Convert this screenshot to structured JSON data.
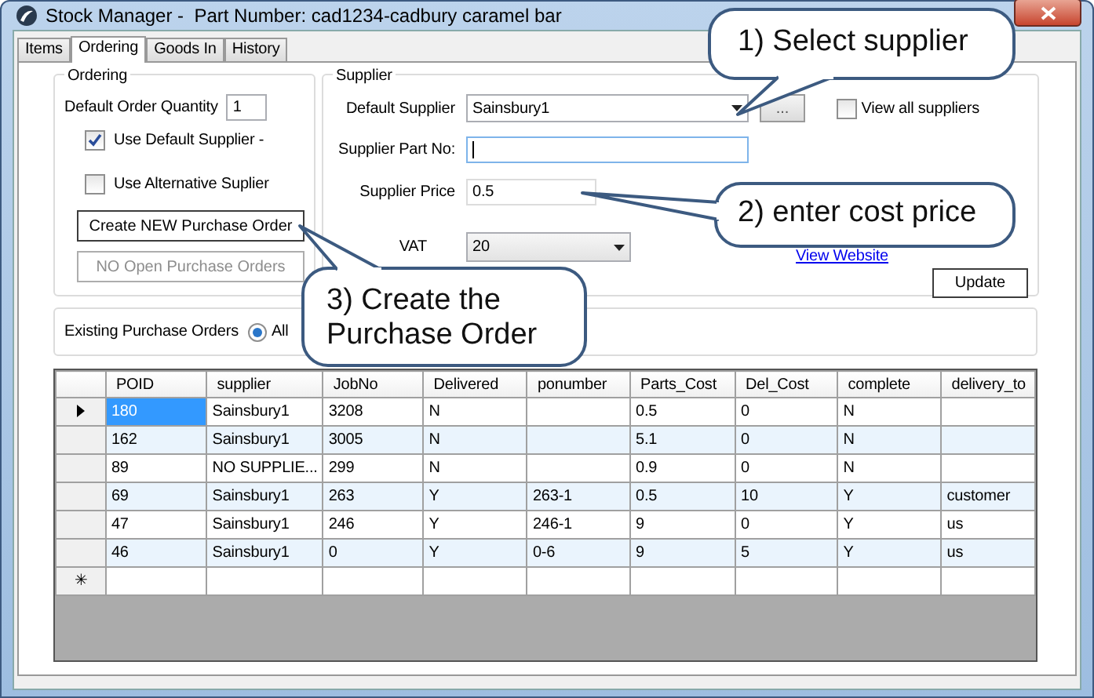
{
  "window": {
    "title": "Stock Manager -  Part Number: cad1234-cadbury caramel bar"
  },
  "tabs": [
    {
      "label": "Items",
      "selected": false
    },
    {
      "label": "Ordering",
      "selected": true
    },
    {
      "label": "Goods In",
      "selected": false
    },
    {
      "label": "History",
      "selected": false
    }
  ],
  "ordering": {
    "title": "Ordering",
    "quantity_label": "Default Order Quantity",
    "quantity_value": "1",
    "checkboxes": [
      {
        "label": "Use Default Supplier -",
        "checked": true
      },
      {
        "label": "Use Alternative Suplier",
        "checked": false
      }
    ],
    "buttons": [
      {
        "label": "Create NEW Purchase Order",
        "disabled": false
      },
      {
        "label": "NO Open Purchase Orders",
        "disabled": true
      }
    ]
  },
  "supplier": {
    "title": "Supplier",
    "default_supplier_label": "Default Supplier",
    "default_supplier_value": "Sainsbury1",
    "browse_button": "...",
    "view_all": {
      "label": "View all suppliers",
      "checked": false
    },
    "part_no_label": "Supplier Part No:",
    "price_label": "Supplier Price",
    "price_value": "0.5",
    "vat_label": "VAT",
    "vat_value": "20",
    "link": "View Website",
    "update_button": "Update"
  },
  "existing": {
    "label": "Existing Purchase Orders",
    "radio": {
      "label": "All",
      "selected": true
    }
  },
  "table": {
    "columns": [
      "POID",
      "supplier",
      "JobNo",
      "Delivered",
      "ponumber",
      "Parts_Cost",
      "Del_Cost",
      "complete",
      "delivery_to"
    ],
    "rows": [
      {
        "cells": [
          "180",
          "Sainsbury1",
          "3208",
          "N",
          "",
          "0.5",
          "0",
          "N",
          ""
        ],
        "selected": true
      },
      {
        "cells": [
          "162",
          "Sainsbury1",
          "3005",
          "N",
          "",
          "5.1",
          "0",
          "N",
          ""
        ],
        "selected": false
      },
      {
        "cells": [
          "89",
          "NO SUPPLIE...",
          "299",
          "N",
          "",
          "0.9",
          "0",
          "N",
          ""
        ],
        "selected": false
      },
      {
        "cells": [
          "69",
          "Sainsbury1",
          "263",
          "Y",
          "263-1",
          "0.5",
          "10",
          "Y",
          "customer"
        ],
        "selected": false
      },
      {
        "cells": [
          "47",
          "Sainsbury1",
          "246",
          "Y",
          "246-1",
          "9",
          "0",
          "Y",
          "us"
        ],
        "selected": false
      },
      {
        "cells": [
          "46",
          "Sainsbury1",
          "0",
          "Y",
          "0-6",
          "9",
          "5",
          "Y",
          "us"
        ],
        "selected": false
      }
    ],
    "new_row_marker": "✳"
  },
  "callouts": [
    {
      "text": "1) Select supplier"
    },
    {
      "text": "2) enter cost price"
    },
    {
      "text": "3) Create the Purchase Order"
    }
  ]
}
